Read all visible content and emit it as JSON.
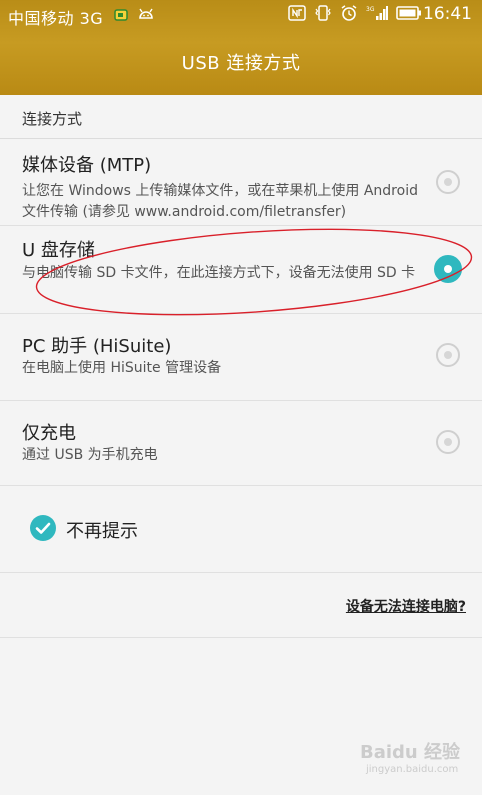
{
  "status_bar": {
    "carrier": "中国移动",
    "network": "3G",
    "time": "16:41",
    "icons": [
      "sim-icon",
      "android-icon",
      "nfc-icon",
      "vibrate-icon",
      "alarm-icon",
      "signal-icon",
      "battery-icon"
    ]
  },
  "header": {
    "title": "USB 连接方式"
  },
  "section": {
    "label": "连接方式"
  },
  "options": [
    {
      "name": "媒体设备 (MTP)",
      "desc": "让您在 Windows 上传输媒体文件，或在苹果机上使用 Android 文件传输 (请参见 www.android.com/filetransfer)",
      "selected": false
    },
    {
      "name": "U 盘存储",
      "desc": "与电脑传输 SD 卡文件，在此连接方式下，设备无法使用 SD 卡",
      "selected": true
    },
    {
      "name": "PC 助手 (HiSuite)",
      "desc": "在电脑上使用 HiSuite 管理设备",
      "selected": false
    },
    {
      "name": "仅充电",
      "desc": "通过 USB 为手机充电",
      "selected": false
    }
  ],
  "checkbox": {
    "label": "不再提示",
    "checked": true
  },
  "help_link": {
    "label": "设备无法连接电脑?"
  },
  "watermark": {
    "text": "Baidu 经验",
    "sub": "jingyan.baidu.com"
  },
  "colors": {
    "header": "#c0951c",
    "accent": "#2fb8bf",
    "annotation": "#d9202a"
  }
}
